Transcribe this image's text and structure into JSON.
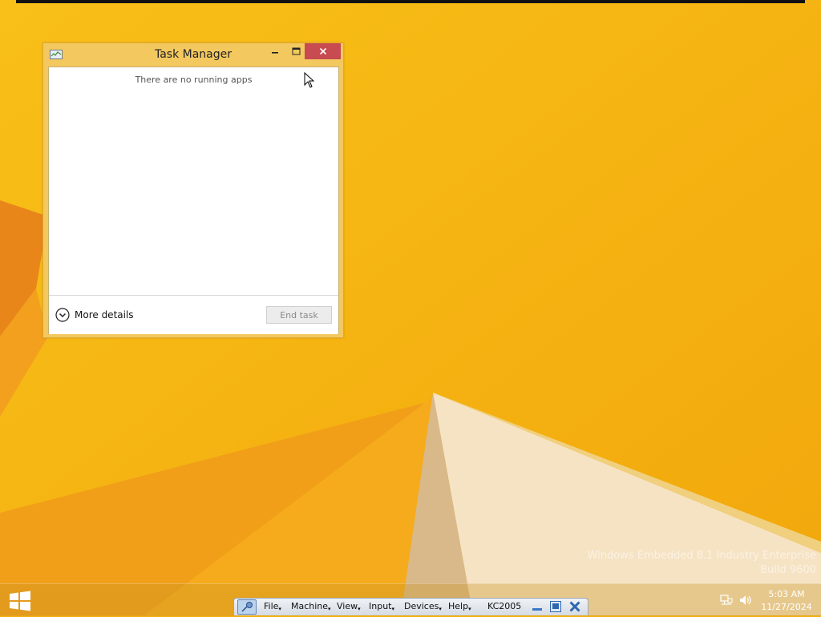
{
  "window": {
    "title": "Task Manager",
    "empty_message": "There are no running apps",
    "more_details_label": "More details",
    "end_task_label": "End task"
  },
  "watermark": {
    "line1": "Windows Embedded 8.1 Industry Enterprise",
    "line2": "Build 9600"
  },
  "vbox_bar": {
    "menus": [
      "File",
      "Machine",
      "View",
      "Input",
      "Devices",
      "Help"
    ],
    "host_name": "KC2005"
  },
  "clock": {
    "time": "5:03 AM",
    "date": "11/27/2024"
  },
  "colors": {
    "desktop": "#f6b10f",
    "close_button": "#c74b50"
  }
}
